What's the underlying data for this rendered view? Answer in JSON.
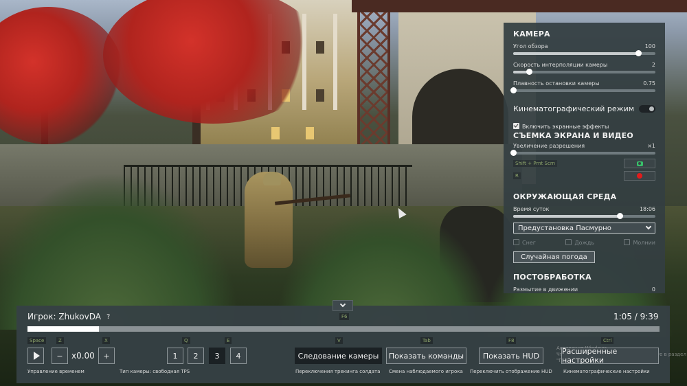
{
  "camera_panel": {
    "camera_section": "КАМЕРА",
    "fov": {
      "label": "Угол обзора",
      "value": "100",
      "fraction": 0.88
    },
    "interp_speed": {
      "label": "Скорость интерполяции камеры",
      "value": "2",
      "fraction": 0.11
    },
    "stop_smooth": {
      "label": "Плавность остановки камеры",
      "value": "0.75",
      "fraction": 0.0
    },
    "cinematic": {
      "label": "Кинематографический режим",
      "enabled": true
    },
    "screen_effects": {
      "label": "Включить экранные эффекты",
      "checked": true
    },
    "capture_section": "СЪЕМКА ЭКРАНА И ВИДЕО",
    "upscale": {
      "label": "Увеличение разрешения",
      "value": "×1",
      "fraction": 0.0
    },
    "screenshot_key": {
      "key1": "Shift",
      "plus": "+",
      "key2": "Prnt Scrn",
      "icon": "camera-icon",
      "color": "#38c06a"
    },
    "record_key": {
      "key": "R",
      "icon": "record-icon",
      "color": "#e21b1b"
    },
    "env_section": "ОКРУЖАЮЩАЯ СРЕДА",
    "time_of_day": {
      "label": "Время суток",
      "value": "18:06",
      "fraction": 0.75
    },
    "weather_preset": "Предустановка Пасмурно",
    "weather_flags": [
      {
        "label": "Снег",
        "checked": false
      },
      {
        "label": "Дождь",
        "checked": false
      },
      {
        "label": "Молнии",
        "checked": false
      }
    ],
    "random_weather": "Случайная погода",
    "post_section": "ПОСТОБРАБОТКА",
    "motion_blur": {
      "label": "Размытие в движении",
      "value": "0",
      "fraction": 0.0
    }
  },
  "bottom_bar": {
    "toggle_hint": "F6",
    "player": "Игрок: ZhukovDA",
    "help": "?",
    "time": "1:05 / 9:39",
    "progress_fraction": 0.113,
    "hints": {
      "space": "Space",
      "z": "Z",
      "x": "X",
      "q": "Q",
      "e": "E",
      "v": "V",
      "tab": "Tab",
      "f8": "F8",
      "ctrl": "Ctrl"
    },
    "speed": "x0.00",
    "minus": "−",
    "plus": "+",
    "camera_types": [
      "1",
      "2",
      "3",
      "4"
    ],
    "active_camera_type": "3",
    "follow_camera": "Следование камеры",
    "show_commands": "Показать команды",
    "show_hud": "Показать HUD",
    "advanced": "Расширенные настройки",
    "captions": {
      "time_control": "Управление временем",
      "camera_type": "Тип камеры: свободная TPS",
      "follow": "Переключения трекинга солдата",
      "observed": "Смена наблюдаемого игрока",
      "hud": "Переключить отображение HUD",
      "cine": "Кинематографические настройки"
    },
    "watermark_title": "Активация Windows",
    "watermark_sub": "Чтобы активировать Windows, перейдите в раздел \"Параметры\"."
  }
}
